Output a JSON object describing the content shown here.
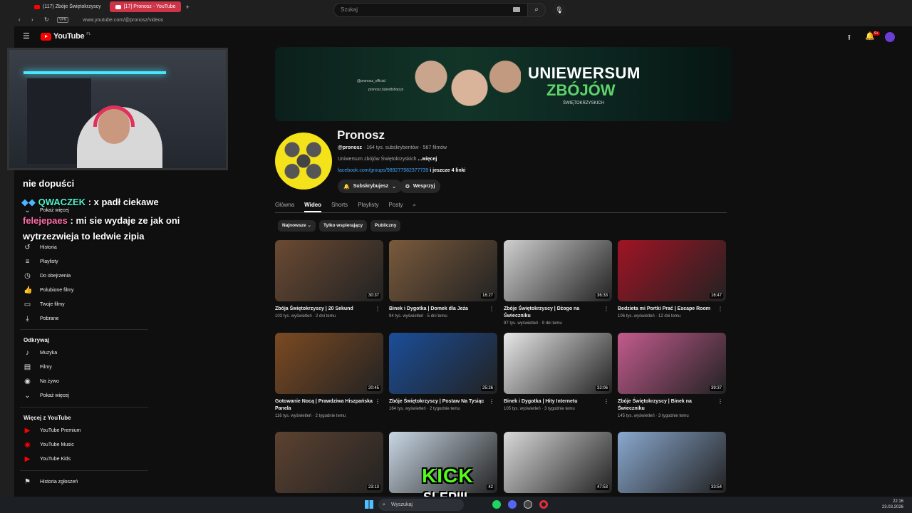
{
  "browser": {
    "tabs": [
      {
        "label": "(117) Zbóje Świętokrzyscy"
      },
      {
        "label": "[17] Pronosz - YouTube"
      }
    ],
    "vpn_label": "VPN",
    "url": "www.youtube.com/@pronosz/videos"
  },
  "header": {
    "logo_text": "YouTube",
    "logo_country": "PL",
    "search_placeholder": "Szukaj",
    "notif_count": "9+"
  },
  "sidebar": {
    "items_top": [
      {
        "label": "Pokaż więcej",
        "icon": "chevron-down-icon"
      },
      {
        "label": "Historia",
        "icon": "history-icon"
      },
      {
        "label": "Playlisty",
        "icon": "playlist-icon"
      },
      {
        "label": "Do obejrzenia",
        "icon": "clock-icon"
      },
      {
        "label": "Polubione filmy",
        "icon": "thumbs-up-icon"
      },
      {
        "label": "Twoje filmy",
        "icon": "video-icon"
      },
      {
        "label": "Pobrane",
        "icon": "download-icon"
      }
    ],
    "explore_title": "Odkrywaj",
    "explore_items": [
      {
        "label": "Muzyka",
        "icon": "music-icon"
      },
      {
        "label": "Filmy",
        "icon": "film-icon"
      },
      {
        "label": "Na żywo",
        "icon": "live-icon"
      },
      {
        "label": "Pokaż więcej",
        "icon": "chevron-down-icon"
      }
    ],
    "more_title": "Więcej z YouTube",
    "more_items": [
      {
        "label": "YouTube Premium"
      },
      {
        "label": "YouTube Music"
      },
      {
        "label": "YouTube Kids"
      }
    ],
    "report_label": "Historia zgłoszeń"
  },
  "chat": [
    {
      "user": "",
      "text": "nie dopuści"
    },
    {
      "user": "QWACZEK",
      "text": ": x padł ciekawe"
    },
    {
      "user": "felejepaes",
      "text": ": mi sie wydaje ze jak oni"
    },
    {
      "user": "",
      "text": "wytrzezwieja to ledwie zipia"
    }
  ],
  "banner": {
    "line1": "UNIEWERSUM",
    "line2": "ZBÓJÓW",
    "line3": "ŚWIĘTOKRZYSKICH",
    "social1": "@pronosz_official",
    "social2": "pronosz.tubedtshop.pl"
  },
  "channel": {
    "name": "Pronosz",
    "handle": "@pronosz",
    "stats": "· 164 tys. subskrybentów · 567 filmów",
    "desc": "Uniwersum zbójów Świętokrzyskich",
    "desc_more": "...więcej",
    "link": "facebook.com/groups/989277982377739",
    "link_more": "i jeszcze 4 linki",
    "subscribed_label": "Subskrybujesz",
    "support_label": "Wesprzyj"
  },
  "tabs": [
    "Główna",
    "Wideo",
    "Shorts",
    "Playlisty",
    "Posty"
  ],
  "active_tab": "Wideo",
  "chips": [
    "Najnowsze",
    "Tylko wspierający",
    "Publiczny"
  ],
  "videos": [
    {
      "title": "Zbója Świętokrzyscy | 20 Sekund",
      "meta": "103 tys. wyświetleń · 2 dni temu",
      "duration": "30:37",
      "color": "#6b4a33"
    },
    {
      "title": "Binek i Dygotka | Domek dla Jeża",
      "meta": "94 tys. wyświetleń · 5 dni temu",
      "duration": "16:27",
      "color": "#7a5a3c"
    },
    {
      "title": "Zbóje Świętokrzyscy | Dżogo na Świeczniku",
      "meta": "97 tys. wyświetleń · 9 dni temu",
      "duration": "36:33",
      "color": "#cfcfcf"
    },
    {
      "title": "Bedzieta mi Portki Prać | Escape Room",
      "meta": "106 tys. wyświetleń · 12 dni temu",
      "duration": "16:47",
      "color": "#a01424"
    },
    {
      "title": "Gotowanie Nocą | Prawdziwa Hiszpańska Panela",
      "meta": "116 tys. wyświetleń · 2 tygodnie temu",
      "duration": "20:45",
      "color": "#7c4a22"
    },
    {
      "title": "Zbóje Świętokrzyscy | Postaw Na Tysiąc",
      "meta": "164 tys. wyświetleń · 2 tygodnie temu",
      "duration": "25:26",
      "color": "#1b4e9a"
    },
    {
      "title": "Binek i Dygotka | Hity Internetu",
      "meta": "105 tys. wyświetleń · 3 tygodnie temu",
      "duration": "32:06",
      "color": "#e8e8e8"
    },
    {
      "title": "Zbóje Świętokrzyscy | Binek na Świeczniku",
      "meta": "145 tys. wyświetleń · 3 tygodnie temu",
      "duration": "39:37",
      "color": "#c35b8d"
    },
    {
      "title": "",
      "meta": "",
      "duration": "23:13",
      "color": "#5c4230"
    },
    {
      "title": "",
      "meta": "",
      "duration": "42",
      "color": "#c9d7e4"
    },
    {
      "title": "",
      "meta": "",
      "duration": "47:53",
      "color": "#d9d9d9"
    },
    {
      "title": "",
      "meta": "",
      "duration": "33:54",
      "color": "#8aa8cf"
    }
  ],
  "overlay": {
    "kick": "KICK",
    "slep": "SLEPIII"
  },
  "taskbar": {
    "search_label": "Wyszukaj",
    "time": "22:16",
    "date": "23.03.2026"
  },
  "colors": {
    "accent_red": "#ff0000",
    "link_blue": "#3ea6ff",
    "banner_green": "#5fd36c",
    "kick_green": "#53fc18"
  }
}
